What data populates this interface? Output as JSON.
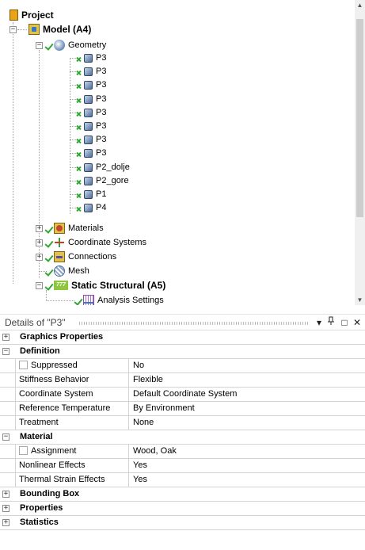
{
  "tree": {
    "project_label": "Project",
    "model_label": "Model (A4)",
    "geometry_label": "Geometry",
    "bodies": [
      "P3",
      "P3",
      "P3",
      "P3",
      "P3",
      "P3",
      "P3",
      "P3",
      "P2_dolje",
      "P2_gore",
      "P1",
      "P4"
    ],
    "materials_label": "Materials",
    "coordinate_systems_label": "Coordinate Systems",
    "connections_label": "Connections",
    "mesh_label": "Mesh",
    "static_structural_label": "Static Structural (A5)",
    "static_structural_icon_text": "777",
    "analysis_settings_label": "Analysis Settings"
  },
  "details": {
    "title": "Details of \"P3\"",
    "header_buttons": {
      "dropdown": "▾",
      "pin": "ᵖ",
      "maximize": "□",
      "close": "✕"
    },
    "groups": {
      "graphics_properties": "Graphics Properties",
      "definition": "Definition",
      "material": "Material",
      "bounding_box": "Bounding Box",
      "properties": "Properties",
      "statistics": "Statistics"
    },
    "definition": {
      "suppressed": {
        "name": "Suppressed",
        "value": "No"
      },
      "stiffness_behavior": {
        "name": "Stiffness Behavior",
        "value": "Flexible"
      },
      "coordinate_system": {
        "name": "Coordinate System",
        "value": "Default Coordinate System"
      },
      "reference_temperature": {
        "name": "Reference Temperature",
        "value": "By Environment"
      },
      "treatment": {
        "name": "Treatment",
        "value": "None"
      }
    },
    "material": {
      "assignment": {
        "name": "Assignment",
        "value": "Wood, Oak"
      },
      "nonlinear_effects": {
        "name": "Nonlinear Effects",
        "value": "Yes"
      },
      "thermal_strain_effects": {
        "name": "Thermal Strain Effects",
        "value": "Yes"
      }
    }
  },
  "icons": {
    "project": "project-icon",
    "model": "model-icon",
    "geometry": "geometry-icon",
    "body": "solid-body-icon",
    "materials": "materials-icon",
    "coordinate_systems": "coordinate-systems-icon",
    "connections": "connections-icon",
    "mesh": "mesh-icon",
    "static_structural": "static-structural-icon",
    "analysis_settings": "analysis-settings-icon",
    "status_ok": "green-check-icon",
    "status_body": "green-x-check-icon"
  },
  "colors": {
    "status_green": "#2fa82f",
    "static_structural_badge": "#8ec63f"
  }
}
